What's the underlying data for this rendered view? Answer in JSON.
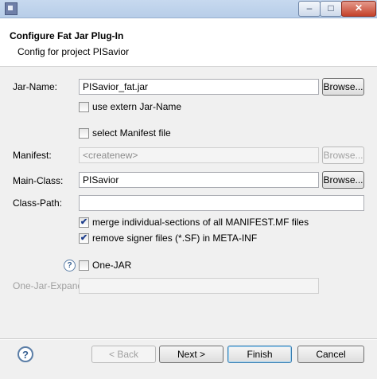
{
  "window": {
    "minimize_glyph": "–",
    "maximize_glyph": "□",
    "close_glyph": "✕"
  },
  "header": {
    "title": "Configure Fat Jar Plug-In",
    "subtitle": "Config for project PISavior"
  },
  "form": {
    "jar_name": {
      "label": "Jar-Name:",
      "value": "PISavior_fat.jar",
      "browse": "Browse..."
    },
    "use_extern": {
      "label": "use extern Jar-Name",
      "checked": false
    },
    "select_manifest": {
      "label": "select Manifest file",
      "checked": false
    },
    "manifest": {
      "label": "Manifest:",
      "value": "<createnew>",
      "browse": "Browse..."
    },
    "main_class": {
      "label": "Main-Class:",
      "value": "PISavior",
      "browse": "Browse..."
    },
    "class_path": {
      "label": "Class-Path:",
      "value": ""
    },
    "merge_sections": {
      "label": "merge individual-sections of all MANIFEST.MF files",
      "checked": true
    },
    "remove_signer": {
      "label": "remove signer files (*.SF) in META-INF",
      "checked": true
    },
    "one_jar": {
      "label": "One-JAR",
      "checked": false
    },
    "one_jar_expand": {
      "label": "One-Jar-Expand:",
      "value": ""
    }
  },
  "checkmark": "✔",
  "help_glyph": "?",
  "footer": {
    "back": "< Back",
    "next": "Next >",
    "finish": "Finish",
    "cancel": "Cancel"
  }
}
